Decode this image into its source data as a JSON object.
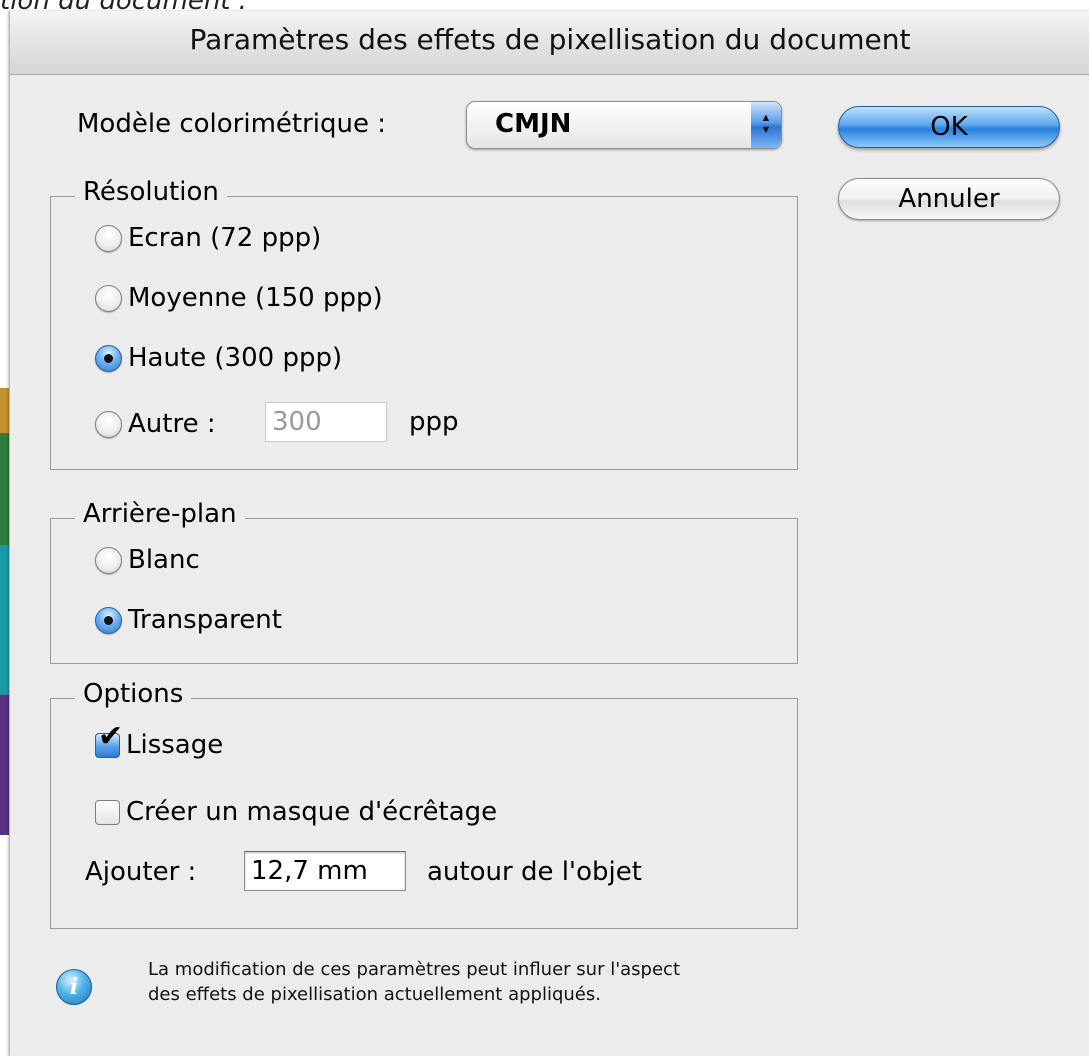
{
  "page_caption": "tion du document :",
  "dialog": {
    "title": "Paramètres des effets de pixellisation du document",
    "color_model": {
      "label": "Modèle colorimétrique :",
      "value": "CMJN"
    },
    "buttons": {
      "ok": "OK",
      "cancel": "Annuler"
    },
    "resolution": {
      "legend": "Résolution",
      "options": [
        {
          "label": "Ecran (72 ppp)",
          "selected": false
        },
        {
          "label": "Moyenne (150 ppp)",
          "selected": false
        },
        {
          "label": "Haute (300 ppp)",
          "selected": true
        },
        {
          "label": "Autre :",
          "selected": false
        }
      ],
      "other_value": "300",
      "other_unit": "ppp"
    },
    "background": {
      "legend": "Arrière-plan",
      "options": [
        {
          "label": "Blanc",
          "selected": false
        },
        {
          "label": "Transparent",
          "selected": true
        }
      ]
    },
    "options": {
      "legend": "Options",
      "antialias": {
        "label": "Lissage",
        "checked": true
      },
      "clipping_mask": {
        "label": "Créer un masque d'écrêtage",
        "checked": false
      },
      "add_label": "Ajouter :",
      "add_value": "12,7 mm",
      "add_suffix": "autour de l'objet"
    },
    "info": {
      "icon": "info-icon",
      "text": "La modification de ces paramètres peut influer sur l'aspect des effets de pixellisation actuellement appliqués."
    }
  },
  "colors": {
    "left_strip": [
      "#c6902c",
      "#2d7c3c",
      "#1a9aa6",
      "#5b2f86"
    ]
  }
}
